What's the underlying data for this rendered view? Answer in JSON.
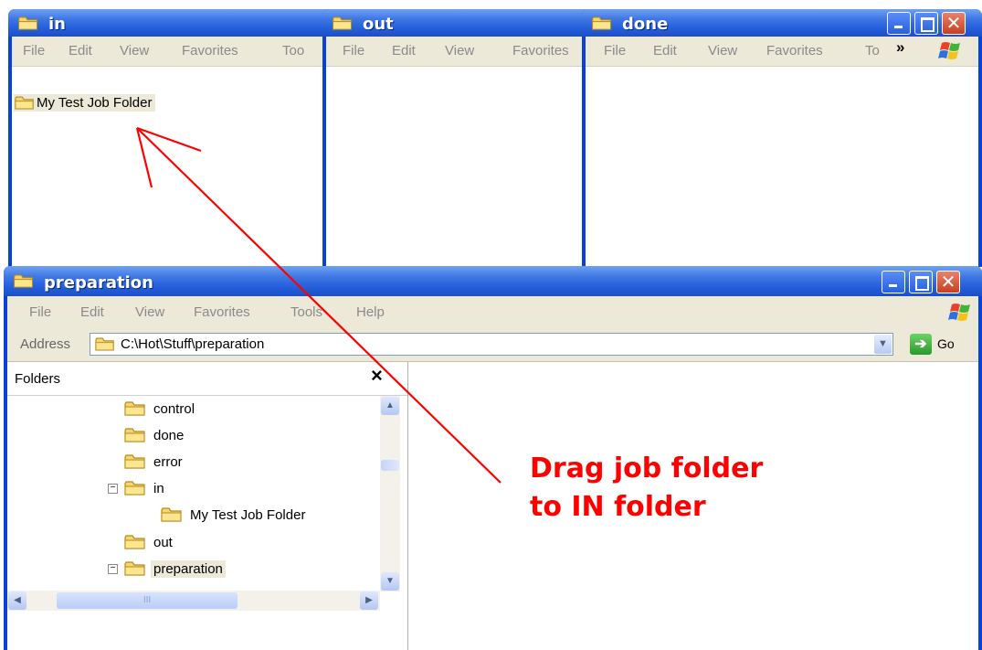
{
  "window_in": {
    "title": "in",
    "menu": [
      "File",
      "Edit",
      "View",
      "Favorites",
      "Too"
    ],
    "items": [
      "My Test Job Folder"
    ]
  },
  "window_out": {
    "title": "out",
    "menu": [
      "File",
      "Edit",
      "View",
      "Favorites"
    ]
  },
  "window_done": {
    "title": "done",
    "menu": [
      "File",
      "Edit",
      "View",
      "Favorites",
      "To"
    ],
    "chevron": "»"
  },
  "window_prep": {
    "title": "preparation",
    "menu": [
      "File",
      "Edit",
      "View",
      "Favorites",
      "Tools",
      "Help"
    ],
    "address_label": "Address",
    "address_value": "C:\\Hot\\Stuff\\preparation",
    "go_label": "Go",
    "folders_label": "Folders",
    "close_glyph": "×",
    "tree": [
      {
        "label": "control",
        "expander": ""
      },
      {
        "label": "done",
        "expander": ""
      },
      {
        "label": "error",
        "expander": ""
      },
      {
        "label": "in",
        "expander": "−"
      },
      {
        "label": "My Test Job Folder",
        "expander": ""
      },
      {
        "label": "out",
        "expander": ""
      },
      {
        "label": "preparation",
        "expander": "−"
      }
    ],
    "hscroll_grip": "III"
  },
  "annotation": {
    "line1": "Drag job folder",
    "line2": "to IN folder",
    "color": "#ff0000"
  },
  "colors": {
    "titlebar": "#245edb",
    "menubar": "#ece9d8",
    "folder": "#f3d37a",
    "accent": "#0842d6"
  },
  "icons": [
    "folder-icon",
    "minimize-icon",
    "maximize-icon",
    "close-icon",
    "windows-logo-icon",
    "go-arrow-icon",
    "scroll-up-icon",
    "scroll-down-icon",
    "scroll-left-icon",
    "scroll-right-icon"
  ]
}
